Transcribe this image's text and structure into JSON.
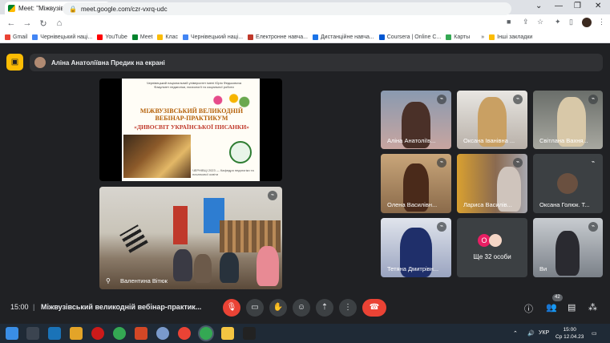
{
  "browser": {
    "tab_title": "Meet: \"Міжвузівський вели",
    "url": "meet.google.com/czr-vxrq-udc",
    "new_tab": "+",
    "bookmarks": [
      {
        "label": "Gmail",
        "color": "#ea4335"
      },
      {
        "label": "Чернівецький наці...",
        "color": "#4285f4"
      },
      {
        "label": "YouTube",
        "color": "#ff0000"
      },
      {
        "label": "Meet",
        "color": "#00832d"
      },
      {
        "label": "Клас",
        "color": "#fbbc04"
      },
      {
        "label": "Чернівецький наці...",
        "color": "#4285f4"
      },
      {
        "label": "Електронне навча...",
        "color": "#c0392b"
      },
      {
        "label": "Дистанційне навча...",
        "color": "#1a73e8"
      },
      {
        "label": "Coursera | Online C...",
        "color": "#0056d2"
      },
      {
        "label": "Карты",
        "color": "#34a853"
      }
    ],
    "bookmarks_more": "»",
    "other_bookmarks": "Інші закладки"
  },
  "meet": {
    "presenting_banner": "Аліна Анатоліївна Предик на екрані",
    "slide": {
      "header": "Чернівецький національний університет імені Юрія Федьковича\nФакультет педагогіки, психології та соціальної роботи",
      "title": "МІЖВУЗІВСЬКИЙ ВЕЛИКОДНІЙ\nВЕБІНАР-ПРАКТИКУМ",
      "subtitle": "«ДИВОСВІТ УКРАЇНСЬКОЇ ПИСАНКИ»",
      "footer": "ЧЕРНІВЦІ 2023 — Кафедра педагогіки та початкової освіти"
    },
    "camera_tile_name": "Валентина Вітюк",
    "participants": [
      {
        "name": "Аліна Анатоліїв..."
      },
      {
        "name": "Оксана Іванівна ..."
      },
      {
        "name": "Світлана Вахня..."
      },
      {
        "name": "Олена Василівн..."
      },
      {
        "name": "Лариса Василів..."
      },
      {
        "name": "Оксана Голюк. Т..."
      },
      {
        "name": "Тетяна Дмитрівн..."
      },
      {
        "name": "Ви"
      }
    ],
    "more_tile": {
      "count_label": "Ще 32 особи",
      "initial": "О"
    },
    "bottom": {
      "time": "15:00",
      "separator": "|",
      "meeting_name": "Міжвузівський великодній вебінар-практик...",
      "participant_count": "42"
    }
  },
  "taskbar": {
    "lang": "УКР",
    "time": "15:00",
    "date": "Ср 12.04.23"
  }
}
